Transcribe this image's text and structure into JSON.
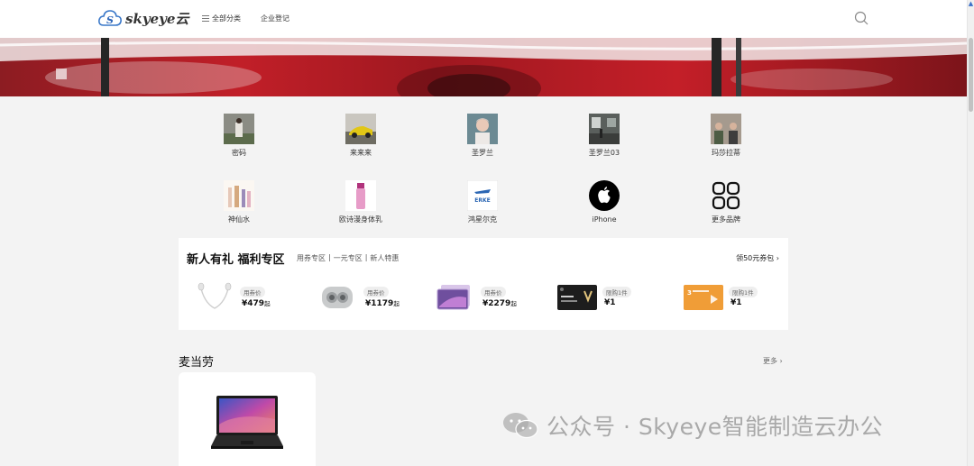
{
  "header": {
    "logo_text": "skyeye云",
    "nav": [
      {
        "label": "全部分类",
        "icon": "menu-icon"
      },
      {
        "label": "企业登记"
      }
    ],
    "search_icon": "search-icon"
  },
  "banner": {
    "icon": "car-banner-image"
  },
  "brands": [
    {
      "label": "密码"
    },
    {
      "label": "来来来"
    },
    {
      "label": "圣罗兰"
    },
    {
      "label": "圣罗兰03"
    },
    {
      "label": "玛莎拉蒂"
    },
    {
      "label": "神仙水"
    },
    {
      "label": "欧诗漫身体乳"
    },
    {
      "label": "鸿星尔克"
    },
    {
      "label": "iPhone"
    },
    {
      "label": "更多品牌"
    }
  ],
  "welfare": {
    "title": "新人有礼 福利专区",
    "subtabs": [
      "用券专区",
      "|",
      "一元专区",
      "|",
      "新人特惠"
    ],
    "coupon_link": "领50元券包 ›",
    "products": [
      {
        "tag": "用券价",
        "price": "¥479",
        "suffix": "起",
        "icon": "earphones-image"
      },
      {
        "tag": "用券价",
        "price": "¥1179",
        "suffix": "起",
        "icon": "earbuds-image"
      },
      {
        "tag": "用券价",
        "price": "¥2279",
        "suffix": "起",
        "icon": "tablet-image"
      },
      {
        "tag": "限购1件",
        "price": "¥1",
        "suffix": "",
        "icon": "vip-card-image"
      },
      {
        "tag": "限购1件",
        "price": "¥1",
        "suffix": "",
        "icon": "video-vip-card-image"
      }
    ]
  },
  "section": {
    "title": "麦当劳",
    "more": "更多 ›",
    "item_icon": "laptop-image"
  },
  "watermark": {
    "text": "公众号 · Skyeye智能制造云办公"
  },
  "colors": {
    "accent": "#c11f28",
    "page_bg": "#f3f3f3"
  }
}
